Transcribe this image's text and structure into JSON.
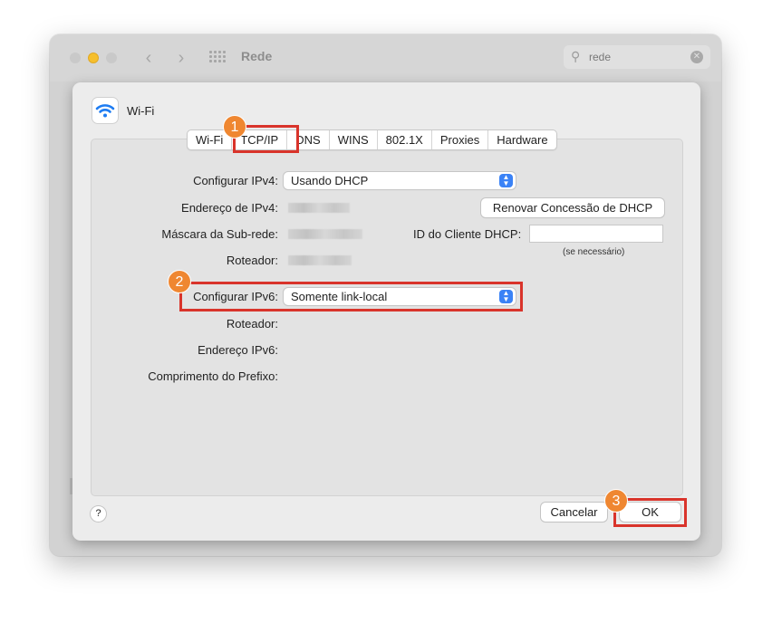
{
  "window": {
    "title": "Rede",
    "search": {
      "value": "rede",
      "placeholder": ""
    }
  },
  "sheet": {
    "interface_label": "Wi-Fi",
    "tabs": [
      "Wi-Fi",
      "TCP/IP",
      "DNS",
      "WINS",
      "802.1X",
      "Proxies",
      "Hardware"
    ],
    "selected_tab": "TCP/IP",
    "ipv4": {
      "configure_label": "Configurar IPv4:",
      "configure_value": "Usando DHCP",
      "address_label": "Endereço de IPv4:",
      "subnet_label": "Máscara da Sub-rede:",
      "router_label": "Roteador:",
      "renew_button": "Renovar Concessão de DHCP",
      "client_id_label": "ID do Cliente DHCP:",
      "client_id_value": "",
      "client_id_hint": "(se necessário)"
    },
    "ipv6": {
      "configure_label": "Configurar IPv6:",
      "configure_value": "Somente link-local",
      "router_label": "Roteador:",
      "address_label": "Endereço IPv6:",
      "prefix_label": "Comprimento do Prefixo:"
    },
    "help_label": "?",
    "cancel_button": "Cancelar",
    "ok_button": "OK"
  },
  "annotations": [
    {
      "number": "1"
    },
    {
      "number": "2"
    },
    {
      "number": "3"
    }
  ],
  "colors": {
    "accent_blue": "#3a82f6",
    "annotation_red": "#d9342b",
    "badge_orange": "#ef8731",
    "wifi_icon": "#1e7cf2"
  }
}
